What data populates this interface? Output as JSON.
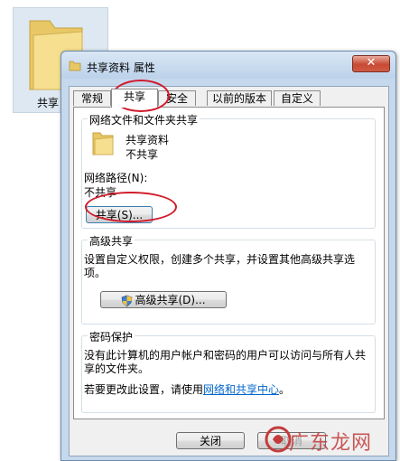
{
  "desktop": {
    "folder_label": "共享"
  },
  "window": {
    "title": "共享资料 属性",
    "close_symbol": "✕"
  },
  "tabs": [
    "常规",
    "共享",
    "安全",
    "以前的版本",
    "自定义"
  ],
  "network_sharing": {
    "group_title": "网络文件和文件夹共享",
    "folder_name": "共享资料",
    "folder_status": "不共享",
    "path_label": "网络路径(N):",
    "path_value": "不共享",
    "share_button": "共享(S)..."
  },
  "advanced_sharing": {
    "group_title": "高级共享",
    "description": "设置自定义权限，创建多个共享，并设置其他高级共享选项。",
    "button": "高级共享(D)..."
  },
  "password_protection": {
    "group_title": "密码保护",
    "description": "没有此计算机的用户帐户和密码的用户可以访问与所有人共享的文件夹。",
    "change_prefix": "若要更改此设置，请使用",
    "change_link": "网络和共享中心",
    "change_suffix": "。"
  },
  "footer": {
    "close_button": "关闭",
    "cancel_button": "取消"
  },
  "watermark": "广东龙网",
  "colors": {
    "highlight_ellipse": "#d11a2a",
    "link": "#0066cc",
    "close_red": "#c74a34"
  }
}
